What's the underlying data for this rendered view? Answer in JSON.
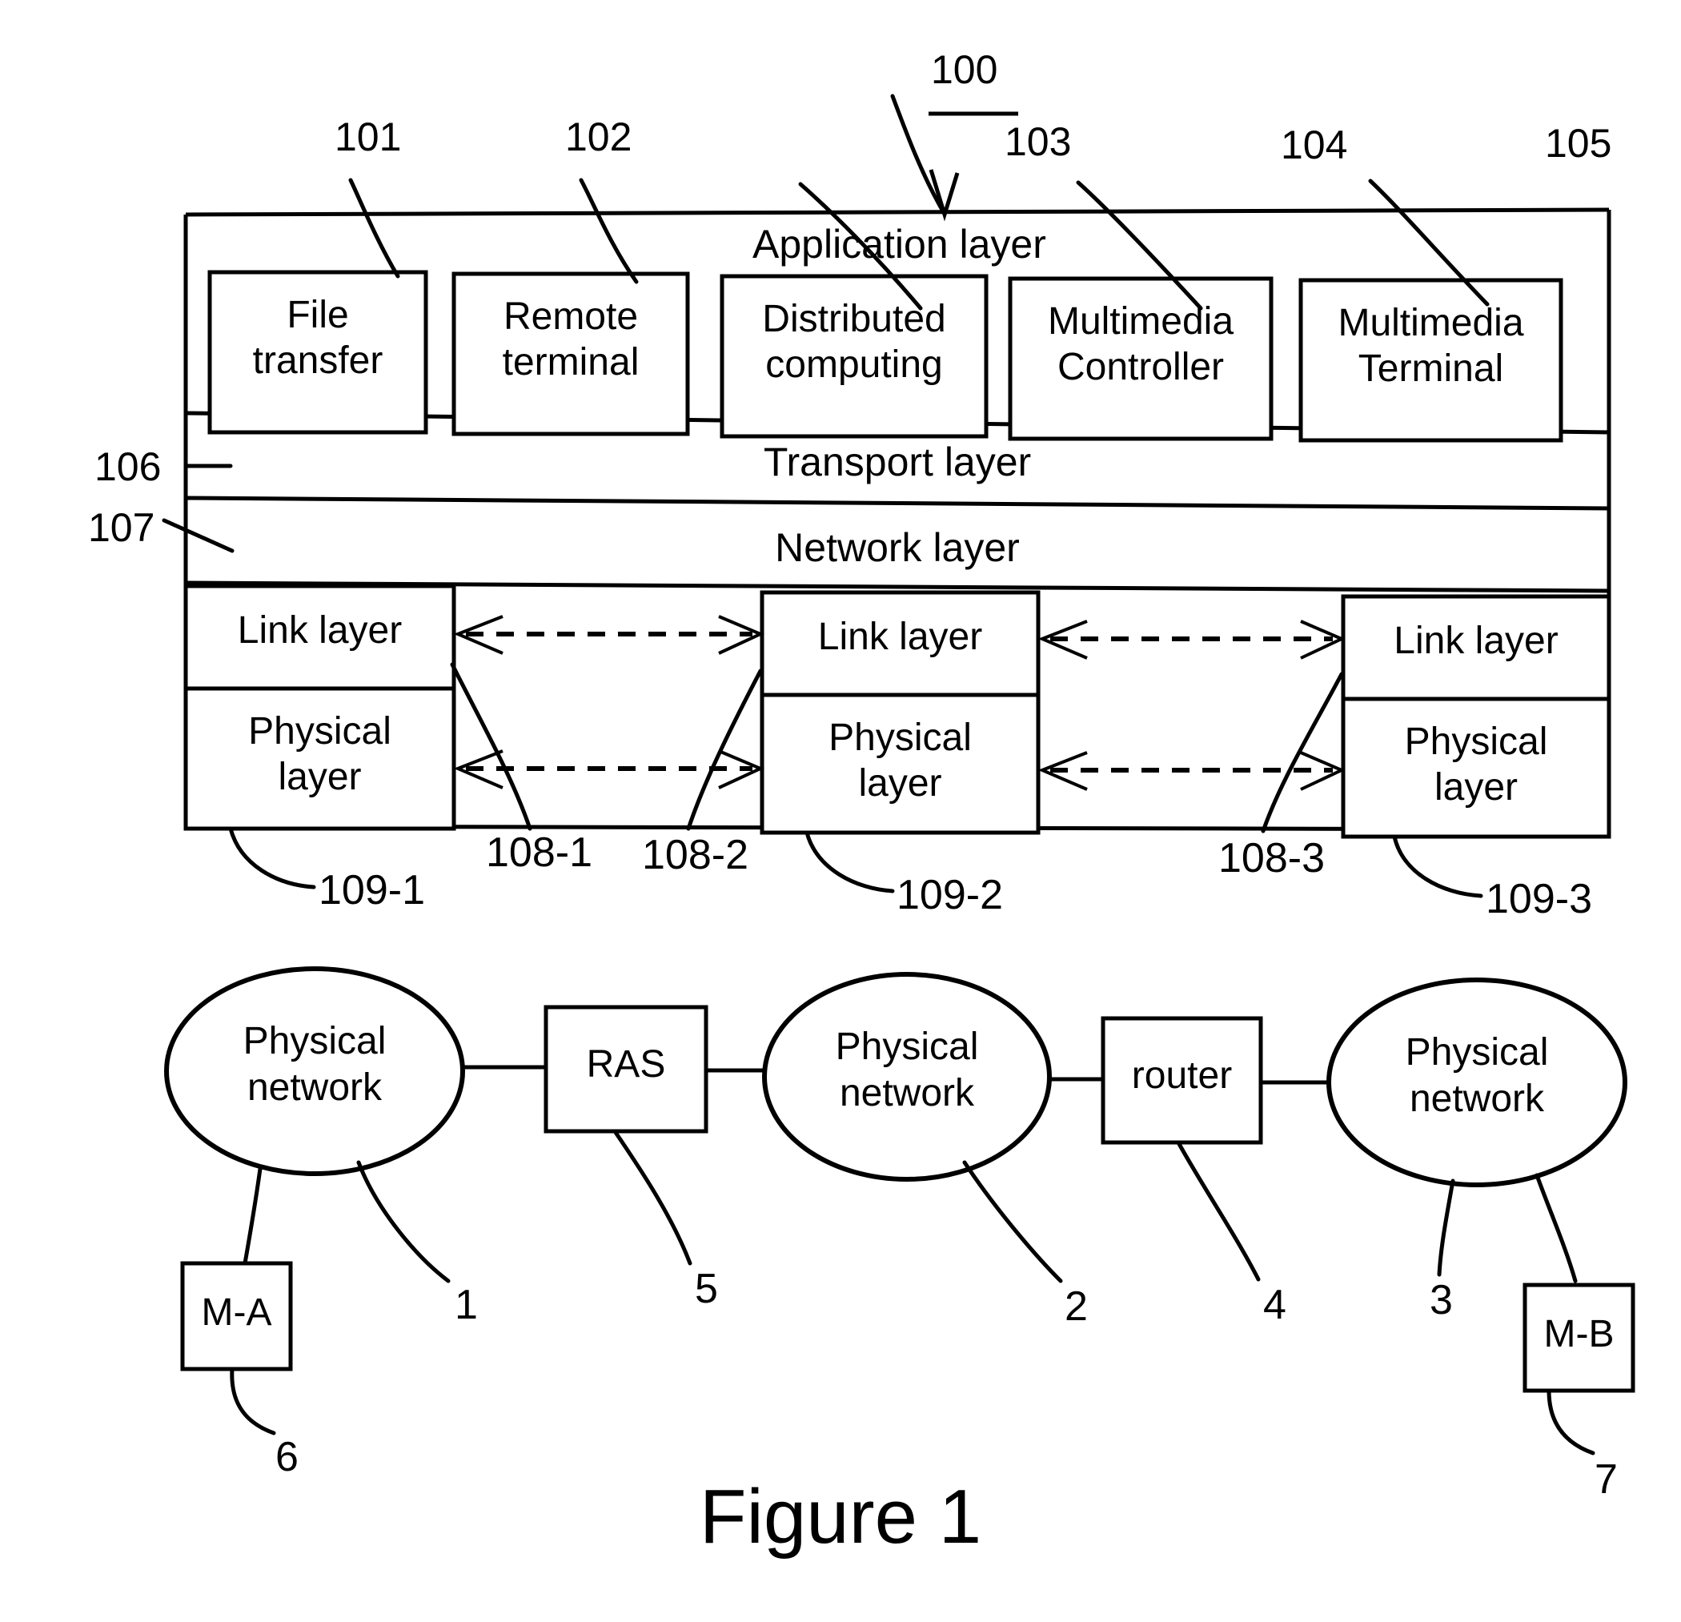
{
  "figure": {
    "caption": "Figure 1",
    "overall_ref": "100"
  },
  "stack_diagram": {
    "application_layer": {
      "band_label": "Application layer",
      "apps": [
        {
          "ref": "101",
          "line1": "File",
          "line2": "transfer"
        },
        {
          "ref": "102",
          "line1": "Remote",
          "line2": "terminal"
        },
        {
          "ref": "103",
          "line1": "Distributed",
          "line2": "computing"
        },
        {
          "ref": "104",
          "line1": "Multimedia",
          "line2": "Controller"
        },
        {
          "ref": "105",
          "line1": "Multimedia",
          "line2": "Terminal"
        }
      ]
    },
    "transport_layer": {
      "label": "Transport layer",
      "ref": "106"
    },
    "network_layer": {
      "label": "Network layer",
      "ref": "107"
    },
    "nodes": [
      {
        "link_label": "Link layer",
        "phys_line1": "Physical",
        "phys_line2": "layer",
        "ref": "109-1"
      },
      {
        "link_label": "Link layer",
        "phys_line1": "Physical",
        "phys_line2": "layer",
        "ref": "109-2"
      },
      {
        "link_label": "Link layer",
        "phys_line1": "Physical",
        "phys_line2": "layer",
        "ref": "109-3"
      }
    ],
    "links": [
      {
        "ref": "108-1"
      },
      {
        "ref": "108-2"
      },
      {
        "ref": "108-3"
      }
    ]
  },
  "network_diagram": {
    "nodes": [
      {
        "type": "ellipse",
        "line1": "Physical",
        "line2": "network",
        "ref": "1"
      },
      {
        "type": "box",
        "label": "RAS",
        "ref": "5"
      },
      {
        "type": "ellipse",
        "line1": "Physical",
        "line2": "network",
        "ref": "2"
      },
      {
        "type": "box",
        "label": "router",
        "ref": "4"
      },
      {
        "type": "ellipse",
        "line1": "Physical",
        "line2": "network",
        "ref": "3"
      }
    ],
    "terminals": [
      {
        "label": "M-A",
        "ref": "6"
      },
      {
        "label": "M-B",
        "ref": "7"
      }
    ]
  },
  "colors": {
    "ink": "#000000",
    "paper": "#ffffff"
  }
}
